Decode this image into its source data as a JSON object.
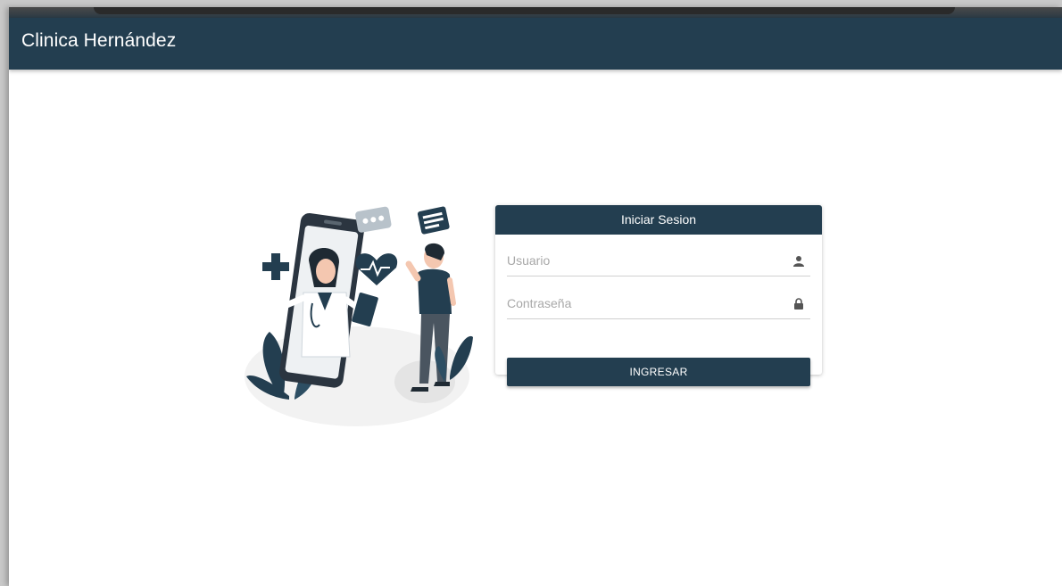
{
  "app": {
    "title": "Clinica Hernández"
  },
  "login": {
    "header": "Iniciar Sesion",
    "username_placeholder": "Usuario",
    "password_placeholder": "Contraseña",
    "submit_label": "INGRESAR",
    "user_icon": "person-icon",
    "password_icon": "lock-icon"
  },
  "colors": {
    "primary": "#233e50",
    "background": "#ffffff"
  }
}
